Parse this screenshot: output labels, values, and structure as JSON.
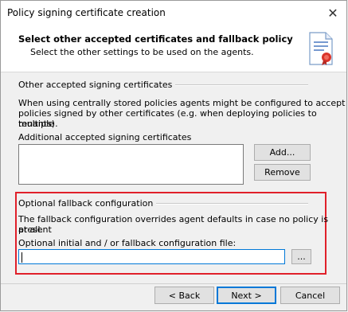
{
  "window": {
    "title": "Policy signing certificate creation",
    "close_glyph": "✕"
  },
  "header": {
    "title": "Select other accepted certificates and fallback policy",
    "subtitle": "Select the other settings to be used on the agents.",
    "icon": "certificate-icon"
  },
  "accepted": {
    "group_label": "Other accepted signing certificates",
    "description_line1": "When using centrally stored policies agents might be configured to accept",
    "description_line2": "policies signed by other certificates (e.g. when deploying policies to multiple",
    "description_line3": "tenants).",
    "list_label": "Additional accepted signing certificates",
    "add_button": "Add...",
    "remove_button": "Remove"
  },
  "fallback": {
    "group_label": "Optional fallback configuration",
    "description_line1": "The fallback configuration overrides agent defaults in case no policy is present",
    "description_line2": "at all.",
    "file_label": "Optional initial and / or fallback configuration file:",
    "file_value": "",
    "browse_button": "..."
  },
  "footer": {
    "back_button": "< Back",
    "next_button": "Next >",
    "cancel_button": "Cancel"
  },
  "colors": {
    "highlight": "#e0202a",
    "focus": "#0078d7"
  }
}
